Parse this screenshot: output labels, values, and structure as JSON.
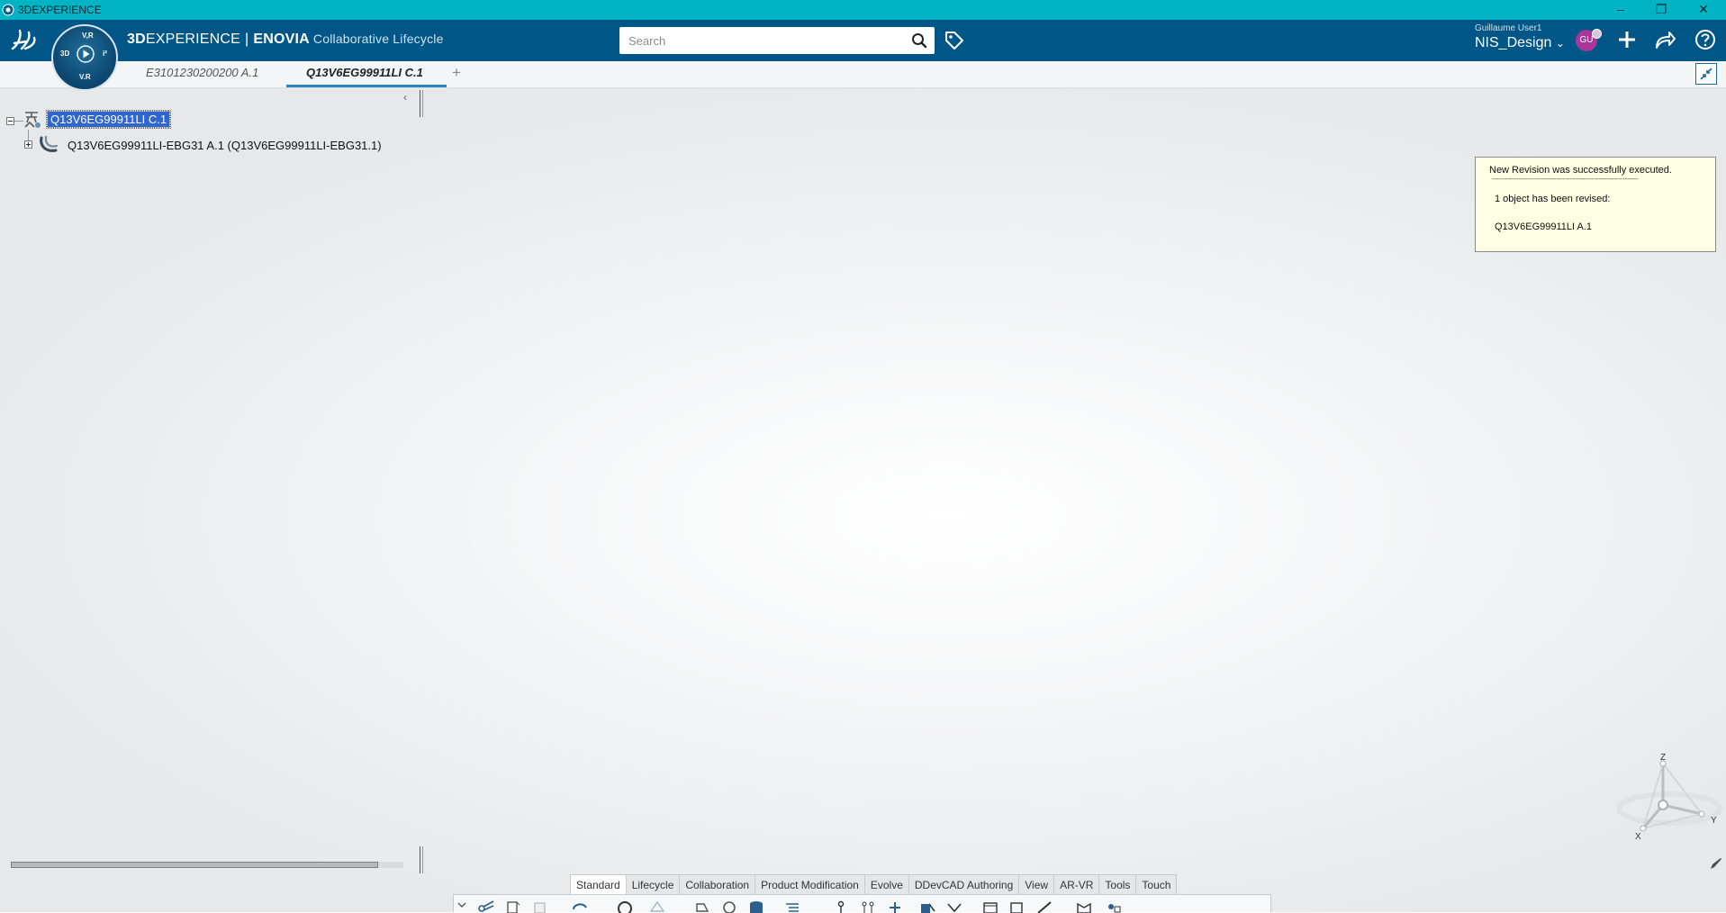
{
  "os_window": {
    "title": "3DEXPERIENCE",
    "minimize_icon": "minimize-icon",
    "restore_icon": "restore-icon",
    "close_icon": "close-icon"
  },
  "header": {
    "brand_3d": "3D",
    "brand_experience": "EXPERIENCE",
    "brand_separator": "|",
    "brand_app": "ENOVIA",
    "brand_subtitle": "Collaborative Lifecycle",
    "search_placeholder": "Search",
    "user_name": "Guillaume User1",
    "workspace": "NIS_Design",
    "avatar_initials": "GU"
  },
  "compass": {
    "top_label": "V,R",
    "left_label": "3D",
    "bottom_label": "V.R",
    "right_label": "i²"
  },
  "tabs": [
    {
      "label": "E3101230200200 A.1",
      "active": false
    },
    {
      "label": "Q13V6EG99911LI C.1",
      "active": true
    }
  ],
  "tab_add_label": "+",
  "tree": {
    "root": "Q13V6EG99911LI C.1",
    "child": "Q13V6EG99911LI-EBG31 A.1 (Q13V6EG99911LI-EBG31.1)"
  },
  "notification": {
    "line1": "New Revision was successfully executed.",
    "divider": "------------------------------------------------------------------",
    "line2": "1 object has been revised:",
    "line3": "Q13V6EG99911LI A.1"
  },
  "axis": {
    "z": "Z",
    "y": "Y",
    "x": "X"
  },
  "action_bar": {
    "tabs": [
      "Standard",
      "Lifecycle",
      "Collaboration",
      "Product Modification",
      "Evolve",
      "DDevCAD Authoring",
      "View",
      "AR-VR",
      "Tools",
      "Touch"
    ],
    "active_tab": "Standard"
  },
  "colors": {
    "os_bar": "#00b4c6",
    "topbar": "#005686",
    "selection": "#2f66cf",
    "tab_accent": "#2a84bf",
    "notify_bg": "#ffffe3",
    "avatar": "#a9379a"
  }
}
